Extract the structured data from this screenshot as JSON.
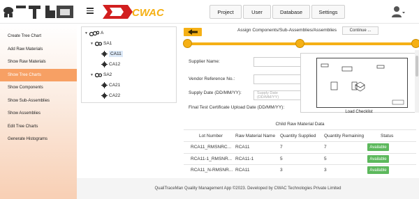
{
  "header": {
    "logo_text": "CWAC",
    "nav": [
      "Project",
      "User",
      "Database",
      "Settings"
    ]
  },
  "sidebar": {
    "items": [
      {
        "label": "Create Tree Chart",
        "active": false
      },
      {
        "label": "Add Raw Materials",
        "active": false
      },
      {
        "label": "Show Raw Materials",
        "active": false
      },
      {
        "label": "Show Tree Charts",
        "active": true
      },
      {
        "label": "Show Components",
        "active": false
      },
      {
        "label": "Show Sub-Assemblies",
        "active": false
      },
      {
        "label": "Show Assemblies",
        "active": false
      },
      {
        "label": "Edit Tree Charts",
        "active": false
      },
      {
        "label": "Generate Histograms",
        "active": false
      }
    ]
  },
  "tree": {
    "root": "A",
    "nodes": [
      {
        "label": "SA1",
        "level": 1,
        "children": [
          {
            "label": "CA11",
            "selected": true
          },
          {
            "label": "CA12",
            "selected": false
          }
        ]
      },
      {
        "label": "SA2",
        "level": 1,
        "children": [
          {
            "label": "CA21",
            "selected": false
          },
          {
            "label": "CA22",
            "selected": false
          }
        ]
      }
    ]
  },
  "main": {
    "breadcrumb": "Assign Components/Sub-Assemblies/Assemblies",
    "continue_label": "Continue ...",
    "form": {
      "supplier_name_label": "Supplier Name:",
      "vendor_ref_label": "Vendor Reference No.:",
      "supply_date_label": "Supply Date (DD/MM/YY):",
      "supply_date_placeholder": "Supply Date (DD/MM/YY)",
      "cert_date_label": "Final Test Certificate Upload Date (DD/MM/YY):"
    },
    "checklist_caption": "Load Checklist"
  },
  "table": {
    "title": "Child Raw Material Data",
    "columns": [
      "Lot Number",
      "Raw Material Name",
      "Quantity Supplied",
      "Quantity Remaining",
      "Status"
    ],
    "rows": [
      {
        "lot": "RCA11_RMSNRC...",
        "name": "RCA11",
        "supplied": "7",
        "remaining": "7",
        "status": "Available"
      },
      {
        "lot": "RCA11-1_RMSNR...",
        "name": "RCA11-1",
        "supplied": "5",
        "remaining": "5",
        "status": "Available"
      },
      {
        "lot": "RCA11_N-RMSNR...",
        "name": "RCA11",
        "supplied": "3",
        "remaining": "3",
        "status": "Available"
      }
    ]
  },
  "footer": {
    "text": "QualiTraceMan Quality Management App ©2023. Developed by CWAC Technologies Private Limited"
  },
  "colors": {
    "accent_orange": "#f7a064",
    "stepper_yellow": "#f5b015",
    "status_green": "#5cb85c",
    "brand_red": "#d21f1f"
  }
}
